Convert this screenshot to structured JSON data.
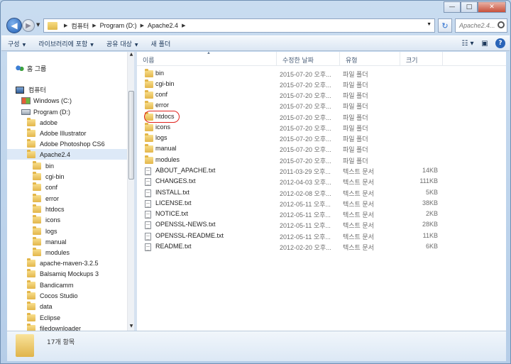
{
  "window": {
    "caption_minimize": "—",
    "caption_maximize": "□",
    "caption_close": "✕"
  },
  "address_bar": {
    "crumbs": [
      "컴퓨터",
      "Program (D:)",
      "Apache2.4"
    ],
    "search_placeholder": "Apache2.4..."
  },
  "toolbar": {
    "items": [
      "구성",
      "라이브러리에 포함",
      "공유 대상",
      "새 폴더"
    ]
  },
  "nav": {
    "homegroup": "홈 그룹",
    "computer": "컴퓨터",
    "drives": [
      "Windows (C:)",
      "Program (D:)"
    ],
    "d_children": [
      "adobe",
      "Adobe Illustrator",
      "Adobe Photoshop CS6",
      "Apache2.4"
    ],
    "apache_children": [
      "bin",
      "cgi-bin",
      "conf",
      "error",
      "htdocs",
      "icons",
      "logs",
      "manual",
      "modules"
    ],
    "more_folders": [
      "apache-maven-3.2.5",
      "Balsamiq Mockups 3",
      "Bandicamm",
      "Cocos Studio",
      "data",
      "Eclipse",
      "filedownloader"
    ]
  },
  "columns": {
    "name": "이름",
    "date": "수정한 날짜",
    "type": "유형",
    "size": "크기"
  },
  "files": [
    {
      "name": "bin",
      "date": "2015-07-20 오후...",
      "type": "파일 폴더",
      "size": "",
      "kind": "folder"
    },
    {
      "name": "cgi-bin",
      "date": "2015-07-20 오후...",
      "type": "파일 폴더",
      "size": "",
      "kind": "folder"
    },
    {
      "name": "conf",
      "date": "2015-07-20 오후...",
      "type": "파일 폴더",
      "size": "",
      "kind": "folder"
    },
    {
      "name": "error",
      "date": "2015-07-20 오후...",
      "type": "파일 폴더",
      "size": "",
      "kind": "folder"
    },
    {
      "name": "htdocs",
      "date": "2015-07-20 오후...",
      "type": "파일 폴더",
      "size": "",
      "kind": "folder"
    },
    {
      "name": "icons",
      "date": "2015-07-20 오후...",
      "type": "파일 폴더",
      "size": "",
      "kind": "folder"
    },
    {
      "name": "logs",
      "date": "2015-07-20 오후...",
      "type": "파일 폴더",
      "size": "",
      "kind": "folder"
    },
    {
      "name": "manual",
      "date": "2015-07-20 오후...",
      "type": "파일 폴더",
      "size": "",
      "kind": "folder"
    },
    {
      "name": "modules",
      "date": "2015-07-20 오후...",
      "type": "파일 폴더",
      "size": "",
      "kind": "folder"
    },
    {
      "name": "ABOUT_APACHE.txt",
      "date": "2011-03-29 오후...",
      "type": "텍스트 문서",
      "size": "14KB",
      "kind": "text"
    },
    {
      "name": "CHANGES.txt",
      "date": "2012-04-03 오후...",
      "type": "텍스트 문서",
      "size": "111KB",
      "kind": "text"
    },
    {
      "name": "INSTALL.txt",
      "date": "2012-02-08 오후...",
      "type": "텍스트 문서",
      "size": "5KB",
      "kind": "text"
    },
    {
      "name": "LICENSE.txt",
      "date": "2012-05-11 오후...",
      "type": "텍스트 문서",
      "size": "38KB",
      "kind": "text"
    },
    {
      "name": "NOTICE.txt",
      "date": "2012-05-11 오후...",
      "type": "텍스트 문서",
      "size": "2KB",
      "kind": "text"
    },
    {
      "name": "OPENSSL-NEWS.txt",
      "date": "2012-05-11 오후...",
      "type": "텍스트 문서",
      "size": "28KB",
      "kind": "text"
    },
    {
      "name": "OPENSSL-README.txt",
      "date": "2012-05-11 오후...",
      "type": "텍스트 문서",
      "size": "11KB",
      "kind": "text"
    },
    {
      "name": "README.txt",
      "date": "2012-02-20 오후...",
      "type": "텍스트 문서",
      "size": "6KB",
      "kind": "text"
    }
  ],
  "highlighted_item": "htdocs",
  "status": {
    "item_count": "17개 항목"
  },
  "colors": {
    "highlight_ring": "#e0231e",
    "selection": "#dde9f7"
  }
}
